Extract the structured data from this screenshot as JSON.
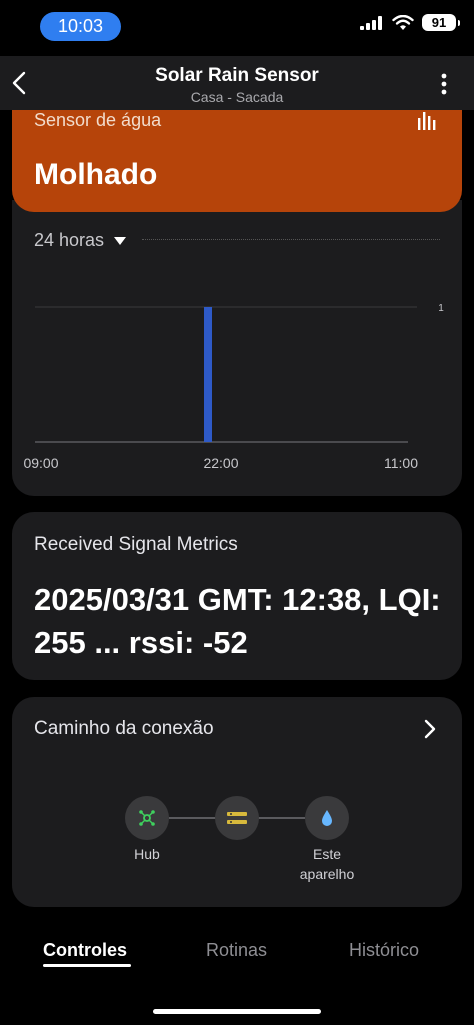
{
  "status_bar": {
    "time": "10:03",
    "battery": "91"
  },
  "header": {
    "title": "Solar Rain Sensor",
    "subtitle": "Casa - Sacada"
  },
  "sensor": {
    "label": "Sensor de água",
    "value": "Molhado",
    "color": "#b6440a"
  },
  "range": {
    "selected": "24 horas"
  },
  "chart_data": {
    "type": "bar",
    "x_ticks": [
      "09:00",
      "22:00",
      "11:00"
    ],
    "y_ticks": [
      "1"
    ],
    "ylim": [
      0,
      1
    ],
    "series": [
      {
        "x": "22:00",
        "y": 1,
        "color": "#2e5ac8"
      }
    ]
  },
  "signal": {
    "title": "Received Signal Metrics",
    "value": "2025/03/31 GMT: 12:38, LQI: 255 ... rssi: -52"
  },
  "connection": {
    "title": "Caminho da conexão",
    "nodes": [
      {
        "label": "Hub",
        "icon": "hub-icon"
      },
      {
        "label": "",
        "icon": "repeater-icon"
      },
      {
        "label": "Este aparelho",
        "icon": "water-drop-icon"
      }
    ]
  },
  "tabs": [
    "Controles",
    "Rotinas",
    "Histórico"
  ]
}
